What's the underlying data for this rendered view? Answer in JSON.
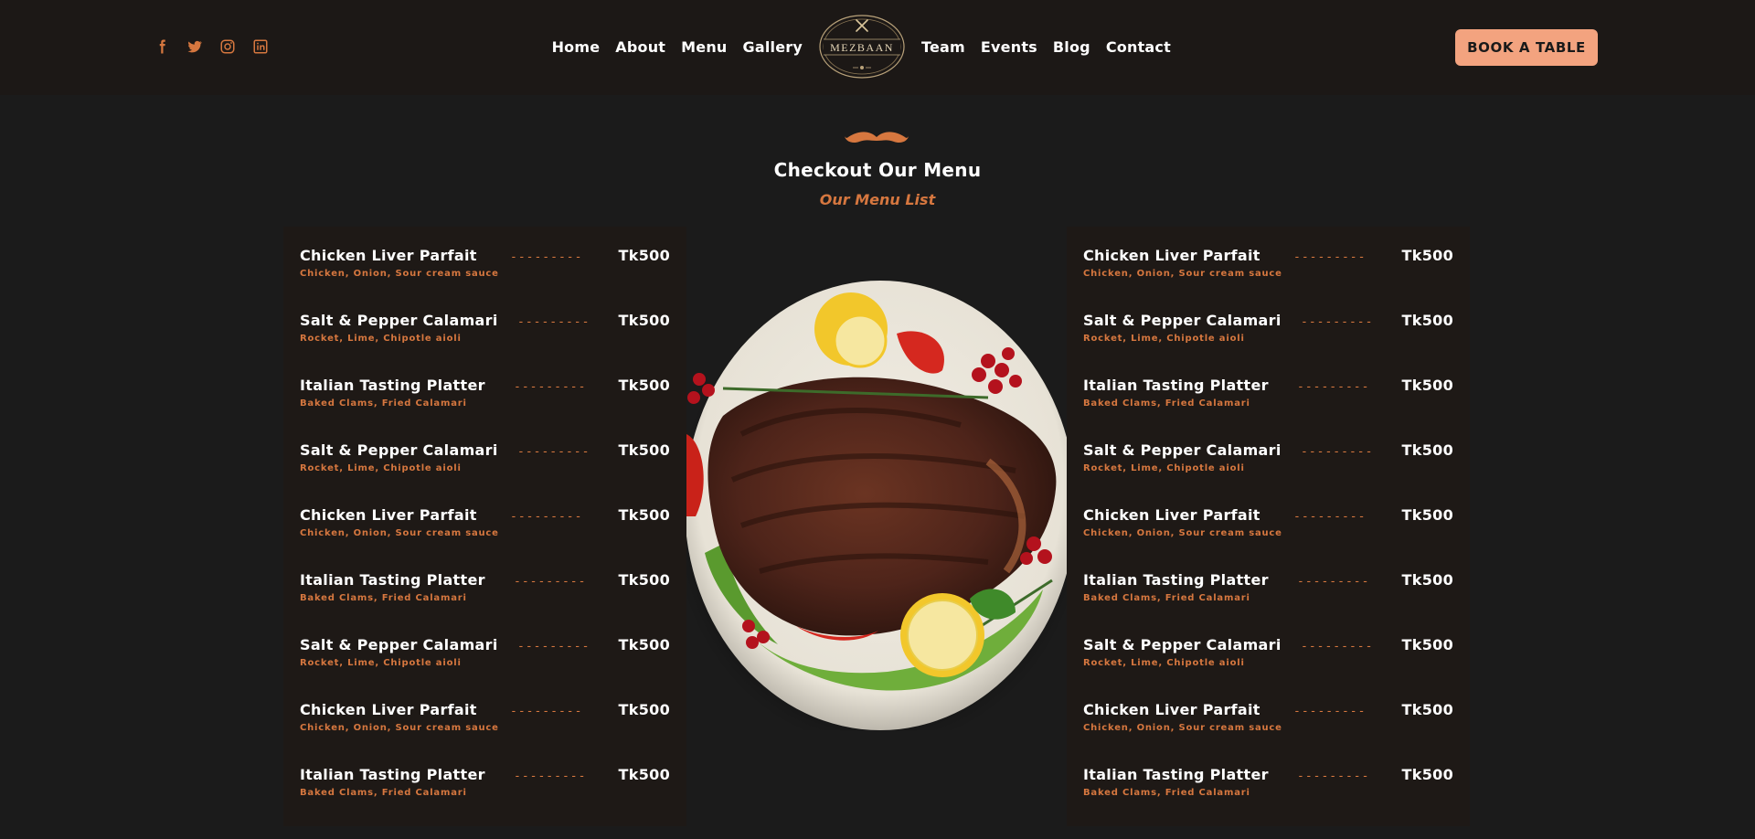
{
  "header": {
    "social": [
      {
        "name": "facebook-icon"
      },
      {
        "name": "twitter-icon"
      },
      {
        "name": "instagram-icon"
      },
      {
        "name": "linkedin-icon"
      }
    ],
    "nav_left": [
      "Home",
      "About",
      "Menu",
      "Gallery"
    ],
    "nav_right": [
      "Team",
      "Events",
      "Blog",
      "Contact"
    ],
    "logo": {
      "text": "MEZBAAN"
    },
    "book_button": "BOOK A TABLE"
  },
  "section": {
    "title": "Checkout Our Menu",
    "subtitle": "Our Menu List"
  },
  "menu": {
    "left": [
      {
        "name": "Chicken Liver Parfait",
        "desc": "Chicken, Onion, Sour cream sauce",
        "price": "Tk500"
      },
      {
        "name": "Salt & Pepper Calamari",
        "desc": "Rocket, Lime, Chipotle aioli",
        "price": "Tk500"
      },
      {
        "name": "Italian Tasting Platter",
        "desc": "Baked Clams, Fried Calamari",
        "price": "Tk500"
      },
      {
        "name": "Salt & Pepper Calamari",
        "desc": "Rocket, Lime, Chipotle aioli",
        "price": "Tk500"
      },
      {
        "name": "Chicken Liver Parfait",
        "desc": "Chicken, Onion, Sour cream sauce",
        "price": "Tk500"
      },
      {
        "name": "Italian Tasting Platter",
        "desc": "Baked Clams, Fried Calamari",
        "price": "Tk500"
      },
      {
        "name": "Salt & Pepper Calamari",
        "desc": "Rocket, Lime, Chipotle aioli",
        "price": "Tk500"
      },
      {
        "name": "Chicken Liver Parfait",
        "desc": "Chicken, Onion, Sour cream sauce",
        "price": "Tk500"
      },
      {
        "name": "Italian Tasting Platter",
        "desc": "Baked Clams, Fried Calamari",
        "price": "Tk500"
      }
    ],
    "right": [
      {
        "name": "Chicken Liver Parfait",
        "desc": "Chicken, Onion, Sour cream sauce",
        "price": "Tk500"
      },
      {
        "name": "Salt & Pepper Calamari",
        "desc": "Rocket, Lime, Chipotle aioli",
        "price": "Tk500"
      },
      {
        "name": "Italian Tasting Platter",
        "desc": "Baked Clams, Fried Calamari",
        "price": "Tk500"
      },
      {
        "name": "Salt & Pepper Calamari",
        "desc": "Rocket, Lime, Chipotle aioli",
        "price": "Tk500"
      },
      {
        "name": "Chicken Liver Parfait",
        "desc": "Chicken, Onion, Sour cream sauce",
        "price": "Tk500"
      },
      {
        "name": "Italian Tasting Platter",
        "desc": "Baked Clams, Fried Calamari",
        "price": "Tk500"
      },
      {
        "name": "Salt & Pepper Calamari",
        "desc": "Rocket, Lime, Chipotle aioli",
        "price": "Tk500"
      },
      {
        "name": "Chicken Liver Parfait",
        "desc": "Chicken, Onion, Sour cream sauce",
        "price": "Tk500"
      },
      {
        "name": "Italian Tasting Platter",
        "desc": "Baked Clams, Fried Calamari",
        "price": "Tk500"
      }
    ]
  },
  "colors": {
    "accent": "#d6773f",
    "button": "#f3a37f",
    "background": "#1b1b1b",
    "header_bg": "#1c1816",
    "panel_bg": "#1e1916"
  }
}
